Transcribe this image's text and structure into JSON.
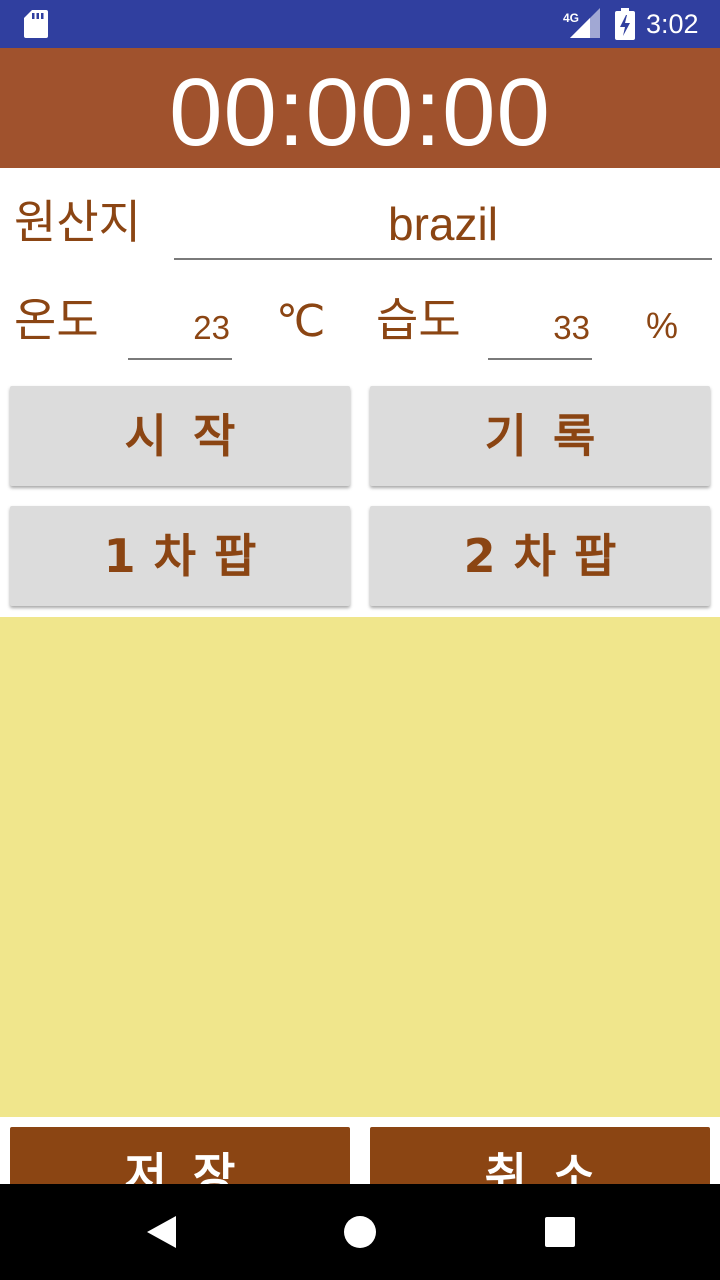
{
  "status_bar": {
    "time": "3:02",
    "network": "4G",
    "icons": [
      "sd-card-icon",
      "signal-icon",
      "battery-charging-icon"
    ]
  },
  "timer": {
    "display": "00:00:00"
  },
  "origin": {
    "label": "원산지",
    "value": "brazil"
  },
  "temperature": {
    "label": "온도",
    "value": "23",
    "unit": "℃"
  },
  "humidity": {
    "label": "습도",
    "value": "33",
    "unit": "%"
  },
  "buttons": {
    "start": "시작",
    "record": "기록",
    "first_crack": "1차팝",
    "second_crack": "2차팝",
    "save": "저장",
    "cancel": "취소"
  },
  "log": {
    "content": ""
  },
  "colors": {
    "status_bar": "#303F9F",
    "timer_bg": "#A0522D",
    "text_brown": "#8B4513",
    "button_gray": "#DCDCDC",
    "log_bg": "#F0E68C",
    "action_button": "#8B4513"
  },
  "nav_bar": {
    "icons": [
      "back-icon",
      "home-icon",
      "recent-apps-icon"
    ]
  }
}
